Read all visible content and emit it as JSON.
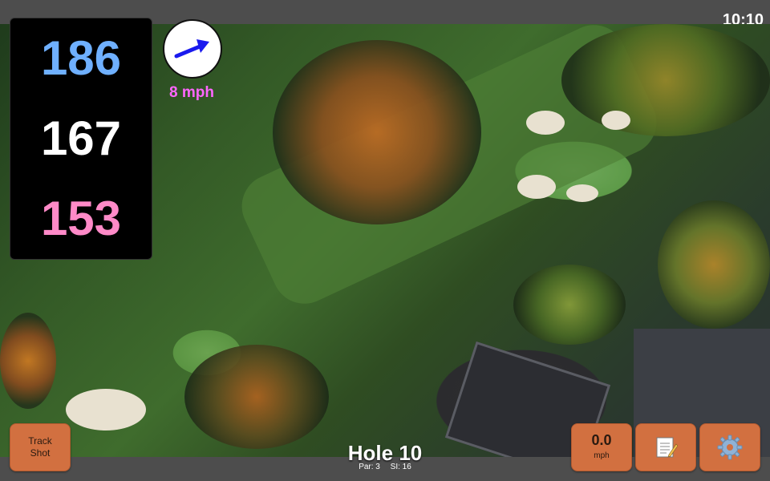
{
  "status": {
    "time": "10:10"
  },
  "yardages": {
    "back": "186",
    "center": "167",
    "front": "153"
  },
  "wind": {
    "speed": "8 mph",
    "icon": "wind-direction-arrow-icon"
  },
  "hole": {
    "title": "Hole 10",
    "par": "Par: 3",
    "si": "SI: 16"
  },
  "buttons": {
    "track_line1": "Track",
    "track_line2": "Shot",
    "speed_value": "0.0",
    "speed_unit": "mph",
    "notes_icon": "notepad-icon",
    "settings_icon": "gear-icon"
  },
  "colors": {
    "back": "#6fb0ff",
    "center": "#ffffff",
    "front": "#ff8ac8",
    "wind_text": "#ff66ff",
    "button": "#d27040"
  }
}
